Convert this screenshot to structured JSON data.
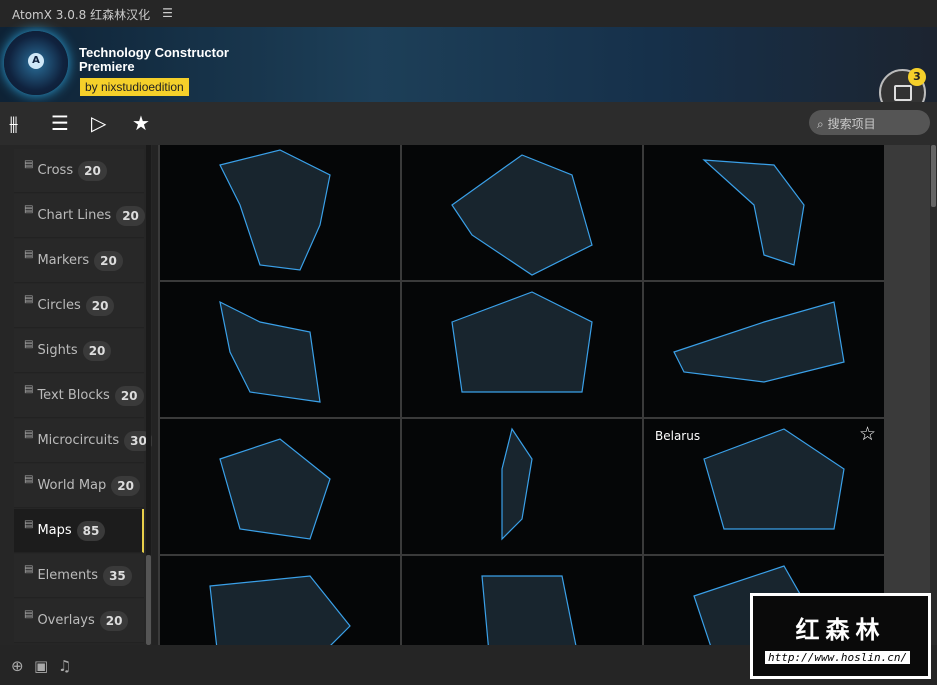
{
  "titlebar": {
    "title": "AtomX 3.0.8 红森林汉化",
    "menu_icon": "hamburger-icon"
  },
  "banner": {
    "title_line1": "Technology Constructor",
    "title_line2": "Premiere",
    "byline": "by nixstudioedition",
    "logo_letter": "A",
    "cart_count": "3"
  },
  "toolbar": {
    "search_placeholder": "搜索项目"
  },
  "sidebar": {
    "items": [
      {
        "label": "Cross",
        "count": "20"
      },
      {
        "label": "Chart Lines",
        "count": "20"
      },
      {
        "label": "Markers",
        "count": "20"
      },
      {
        "label": "Circles",
        "count": "20"
      },
      {
        "label": "Sights",
        "count": "20"
      },
      {
        "label": "Text Blocks",
        "count": "20"
      },
      {
        "label": "Microcircuits",
        "count": "30"
      },
      {
        "label": "World Map",
        "count": "20"
      },
      {
        "label": "Maps",
        "count": "85",
        "active": true
      },
      {
        "label": "Elements",
        "count": "35"
      },
      {
        "label": "Overlays",
        "count": "20"
      }
    ]
  },
  "grid": {
    "hovered_label": "Belarus"
  },
  "watermark": {
    "text": "红森林",
    "url": "http://www.hoslin.cn/"
  },
  "colors": {
    "accent": "#f5d02a",
    "map_line": "#3aa0e8"
  }
}
